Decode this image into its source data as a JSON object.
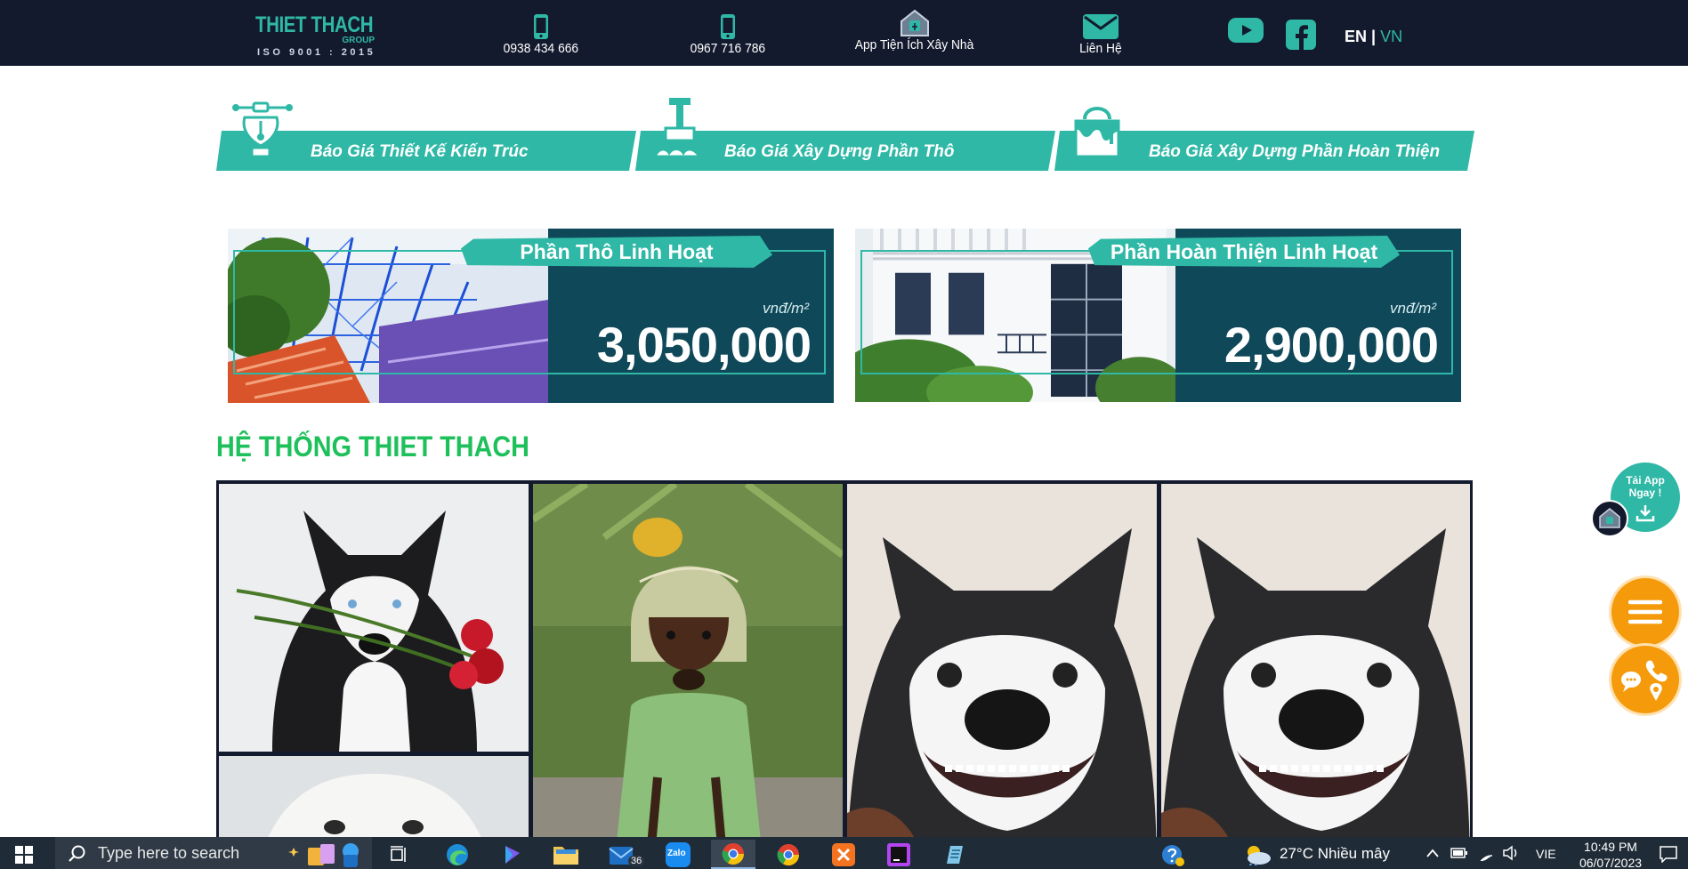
{
  "header": {
    "logo": {
      "name": "THIET THACH",
      "group": "GROUP",
      "iso": "ISO 9001 : 2015"
    },
    "phone1": "0938 434 666",
    "phone2": "0967 716 786",
    "app_link": "App Tiện Ích Xây Nhà",
    "contact": "Liên Hệ",
    "lang_en": "EN",
    "lang_sep": "|",
    "lang_vn": "VN"
  },
  "quotes": [
    {
      "label": "Báo Giá Thiết Kế Kiến Trúc",
      "icon": "pen-tool-icon"
    },
    {
      "label": "Báo Giá Xây Dựng Phần Thô",
      "icon": "trowel-icon"
    },
    {
      "label": "Báo Giá Xây Dựng Phần Hoàn Thiện",
      "icon": "paint-bucket-icon"
    }
  ],
  "banners": [
    {
      "tag": "Phần Thô Linh Hoạt",
      "unit": "vnđ/m²",
      "price": "3,050,000"
    },
    {
      "tag": "Phần Hoàn Thiện Linh Hoạt",
      "unit": "vnđ/m²",
      "price": "2,900,000"
    }
  ],
  "section": {
    "title": "HỆ THỐNG THIET THACH"
  },
  "floating": {
    "app_line1": "Tải App",
    "app_line2": "Ngay !"
  },
  "taskbar": {
    "search_placeholder": "Type here to search",
    "mail_badge": "36",
    "zalo": "Zalo",
    "weather": "27°C  Nhiều mây",
    "lang": "VIE",
    "time": "10:49 PM",
    "date": "06/07/2023"
  },
  "colors": {
    "navy": "#141a2e",
    "teal": "#2fb8a6",
    "green_title": "#1ec05b",
    "orange": "#f59a0b"
  }
}
